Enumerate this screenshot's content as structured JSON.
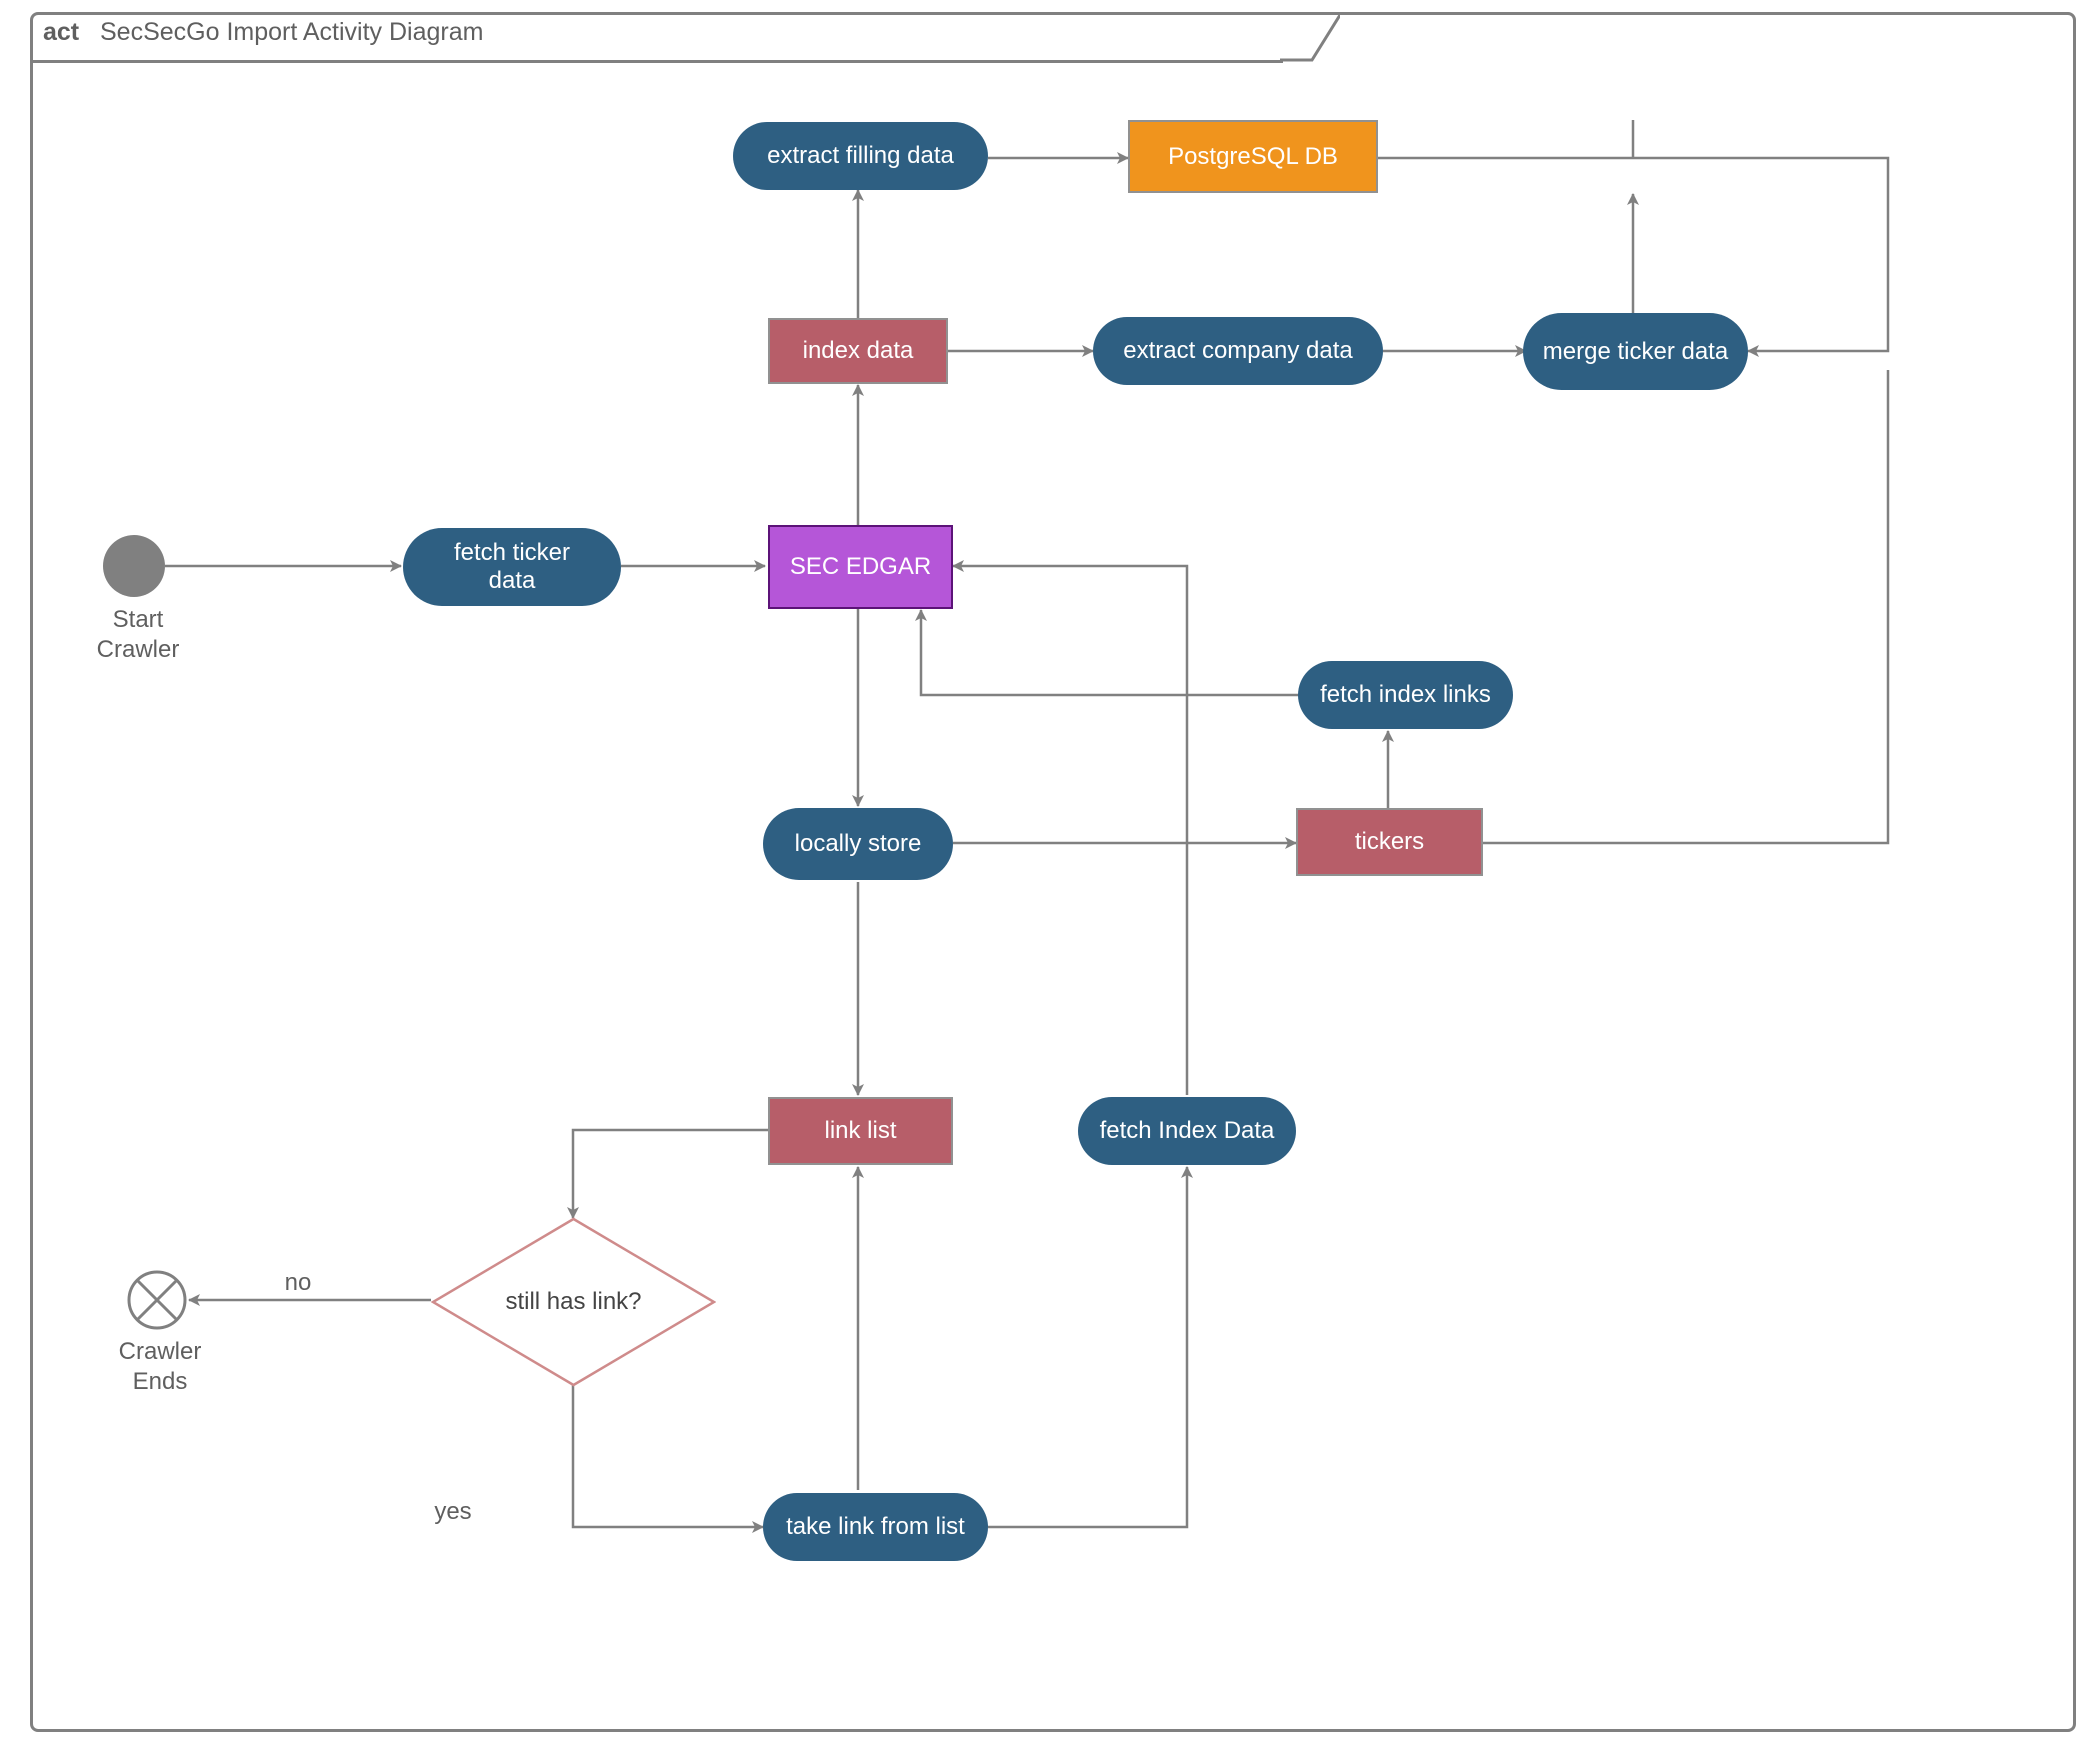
{
  "title": {
    "prefix": "act",
    "text": "SecSecGo Import Activity Diagram"
  },
  "nodes": {
    "start": {
      "label": "Start\nCrawler"
    },
    "end": {
      "label": "Crawler\nEnds"
    },
    "fetch_ticker": {
      "label": "fetch ticker\ndata"
    },
    "sec_edgar": {
      "label": "SEC EDGAR"
    },
    "index_data": {
      "label": "index data"
    },
    "extract_filling": {
      "label": "extract filling data"
    },
    "postgres": {
      "label": "PostgreSQL DB"
    },
    "extract_company": {
      "label": "extract company data"
    },
    "merge_ticker": {
      "label": "merge ticker data"
    },
    "fetch_index_links": {
      "label": "fetch index links"
    },
    "tickers": {
      "label": "tickers"
    },
    "locally_store": {
      "label": "locally store"
    },
    "link_list": {
      "label": "link list"
    },
    "fetch_index_data": {
      "label": "fetch Index Data"
    },
    "take_link": {
      "label": "take link from list"
    },
    "decision": {
      "label": "still has link?"
    }
  },
  "edges": {
    "no": {
      "label": "no"
    },
    "yes": {
      "label": "yes"
    }
  },
  "colors": {
    "pill": "#2e5f82",
    "red": "#b75e69",
    "purple": "#b556d8",
    "orange": "#f0941d",
    "line": "#808080"
  }
}
